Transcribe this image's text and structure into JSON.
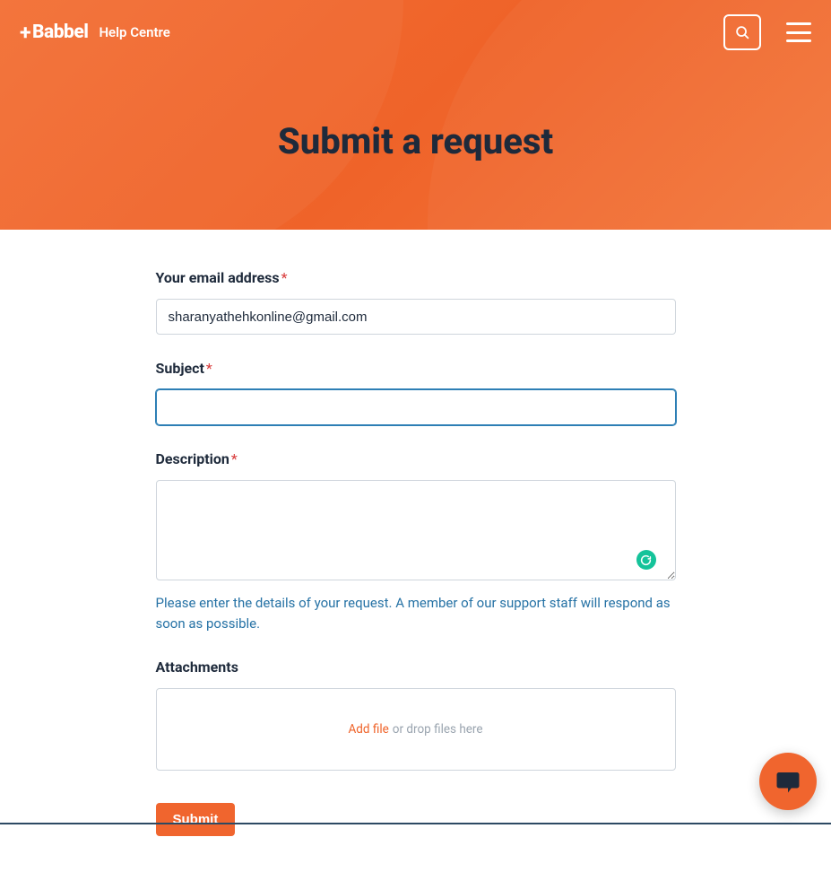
{
  "header": {
    "logo_text": "Babbel",
    "help_centre_label": "Help Centre"
  },
  "page": {
    "title": "Submit a request"
  },
  "form": {
    "email": {
      "label": "Your email address",
      "value": "sharanyathehkonline@gmail.com"
    },
    "subject": {
      "label": "Subject",
      "value": ""
    },
    "description": {
      "label": "Description",
      "value": "",
      "hint": "Please enter the details of your request. A member of our support staff will respond as soon as possible."
    },
    "attachments": {
      "label": "Attachments",
      "add_file_text": "Add file",
      "drop_text": "or drop files here"
    },
    "submit_label": "Submit"
  }
}
